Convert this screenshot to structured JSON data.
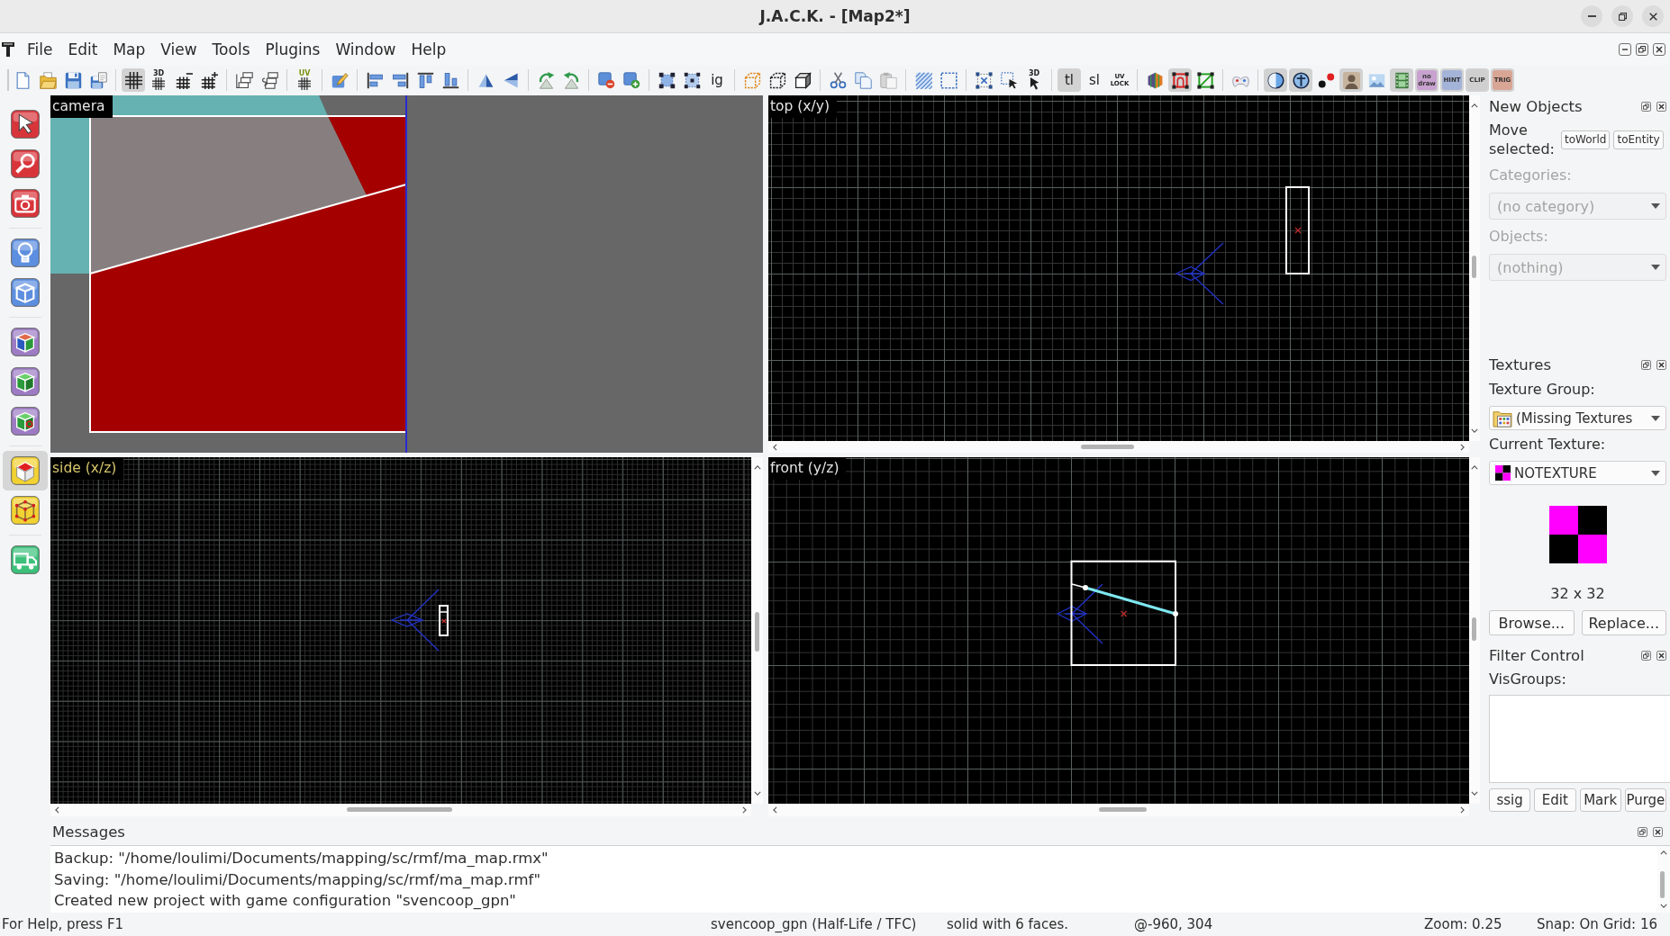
{
  "window": {
    "title": "J.A.C.K. - [Map2*]"
  },
  "menu_bar": [
    "File",
    "Edit",
    "Map",
    "View",
    "Tools",
    "Plugins",
    "Window",
    "Help"
  ],
  "toolbar": [
    {
      "items": [
        {
          "kind": "new",
          "on": false
        },
        {
          "kind": "open",
          "on": false
        },
        {
          "kind": "save",
          "on": false
        },
        {
          "kind": "save_all",
          "on": false
        }
      ]
    },
    {
      "items": [
        {
          "kind": "grid",
          "on": true
        },
        {
          "kind": "grid_3d",
          "label": "3D",
          "on": false
        },
        {
          "kind": "grid_smaller",
          "on": false
        },
        {
          "kind": "grid_larger",
          "on": false
        }
      ]
    },
    {
      "items": [
        {
          "kind": "group",
          "on": false
        },
        {
          "kind": "ungroup",
          "on": false
        }
      ]
    },
    {
      "items": [
        {
          "kind": "grid_uv",
          "label": "UV",
          "on": false
        }
      ]
    },
    {
      "items": [
        {
          "kind": "edit",
          "on": false
        }
      ]
    },
    {
      "items": [
        {
          "kind": "align_left",
          "on": false
        },
        {
          "kind": "align_right",
          "on": false
        },
        {
          "kind": "align_top",
          "on": false
        },
        {
          "kind": "align_bottom",
          "on": false
        }
      ]
    },
    {
      "items": [
        {
          "kind": "flip_h",
          "on": false
        },
        {
          "kind": "flip_v",
          "on": false
        }
      ]
    },
    {
      "items": [
        {
          "kind": "rotate_left",
          "on": false
        },
        {
          "kind": "rotate_right",
          "on": false
        }
      ]
    },
    {
      "items": [
        {
          "kind": "carve",
          "on": false
        },
        {
          "kind": "hollow",
          "on": false
        }
      ]
    },
    {
      "items": [
        {
          "kind": "handles",
          "on": false
        },
        {
          "kind": "handles_mid",
          "on": false
        },
        {
          "kind": "text",
          "label": "ig",
          "on": false
        }
      ]
    },
    {
      "items": [
        {
          "kind": "cube_orange",
          "on": false
        },
        {
          "kind": "cube_dashed",
          "on": false
        },
        {
          "kind": "cube",
          "on": false
        }
      ]
    },
    {
      "items": [
        {
          "kind": "cut",
          "on": false
        },
        {
          "kind": "copy",
          "on": false
        },
        {
          "kind": "paste",
          "on": false
        }
      ]
    },
    {
      "items": [
        {
          "kind": "hatch",
          "on": false
        },
        {
          "kind": "dashed_square",
          "on": false
        }
      ]
    },
    {
      "items": [
        {
          "kind": "cross_square",
          "on": false
        },
        {
          "kind": "select_cursor",
          "on": false
        },
        {
          "kind": "cursor_3d",
          "label": "3D",
          "on": false
        }
      ]
    },
    {
      "items": [
        {
          "kind": "text",
          "label": "tl",
          "on": true
        },
        {
          "kind": "text",
          "label": "sl",
          "on": false
        },
        {
          "kind": "lock",
          "label": "UV LOCK",
          "on": false
        }
      ]
    },
    {
      "items": [
        {
          "kind": "textured_box",
          "on": false
        },
        {
          "kind": "red_frame",
          "on": true
        },
        {
          "kind": "green_frame",
          "on": false
        }
      ]
    },
    {
      "items": [
        {
          "kind": "gamepad",
          "on": false
        }
      ]
    },
    {
      "items": [
        {
          "kind": "circle",
          "on": true
        },
        {
          "kind": "circle_cross",
          "on": true
        },
        {
          "kind": "dots",
          "on": false
        },
        {
          "kind": "person",
          "on": true
        },
        {
          "kind": "image",
          "on": false
        },
        {
          "kind": "film",
          "on": true
        },
        {
          "kind": "tag",
          "label": "no draw",
          "color": "#c8a2cf",
          "on": true
        },
        {
          "kind": "tag",
          "label": "HINT",
          "color": "#a4b3d8",
          "on": true
        },
        {
          "kind": "tag",
          "label": "CLIP",
          "color": "#cfcfcf",
          "on": true
        },
        {
          "kind": "tag",
          "label": "TRIG",
          "color": "#d9a695",
          "on": true
        }
      ]
    }
  ],
  "tools": [
    {
      "items": [
        {
          "kind": "select",
          "selected": false
        },
        {
          "kind": "magnify",
          "selected": false
        },
        {
          "kind": "camera",
          "selected": false
        }
      ]
    },
    {
      "items": [
        {
          "kind": "entity",
          "selected": false
        },
        {
          "kind": "block",
          "selected": false
        }
      ]
    },
    {
      "items": [
        {
          "kind": "texture",
          "selected": false
        },
        {
          "kind": "apply_texture",
          "selected": false
        },
        {
          "kind": "decal",
          "selected": false
        }
      ]
    },
    {
      "items": [
        {
          "kind": "face_edit",
          "selected": true
        },
        {
          "kind": "vertex",
          "selected": false
        }
      ]
    },
    {
      "items": [
        {
          "kind": "path",
          "selected": false
        }
      ]
    }
  ],
  "viewports": [
    {
      "kind": "camera",
      "label": "camera",
      "selected": false
    },
    {
      "kind": "top",
      "label": "top (x/y)",
      "selected": false
    },
    {
      "kind": "side",
      "label": "side (x/z)",
      "selected": true
    },
    {
      "kind": "front",
      "label": "front (y/z)",
      "selected": false
    }
  ],
  "new_objects": {
    "title": "New Objects",
    "move_label": "Move selected:",
    "move_buttons": [
      "toWorld",
      "toEntity"
    ],
    "fields": [
      {
        "label": "Categories:",
        "value": "(no category)",
        "disabled": true
      },
      {
        "label": "Objects:",
        "value": "(nothing)",
        "disabled": true
      }
    ]
  },
  "textures": {
    "title": "Textures",
    "fields": [
      {
        "kind": "group",
        "label": "Texture Group:",
        "value": "(Missing Textures"
      },
      {
        "kind": "texture",
        "label": "Current Texture:",
        "value": "NOTEXTURE"
      }
    ],
    "size": "32 x 32",
    "buttons": [
      "Browse...",
      "Replace..."
    ]
  },
  "filter_control": {
    "title": "Filter Control",
    "visgroups_label": "VisGroups:",
    "buttons": [
      "ssig",
      "Edit",
      "Mark",
      "Purge"
    ]
  },
  "messages": {
    "title": "Messages",
    "lines": [
      "Backup: \"/home/loulimi/Documents/mapping/sc/rmf/ma_map.rmx\"",
      "Saving: \"/home/loulimi/Documents/mapping/sc/rmf/ma_map.rmf\"",
      "Created new project with game configuration \"svencoop_gpn\""
    ]
  },
  "status_bar": [
    "For Help, press F1",
    "svencoop_gpn (Half-Life / TFC)",
    "solid with 6 faces.",
    "@-960, 304",
    "Zoom: 0.25",
    "Snap: On Grid: 16"
  ]
}
